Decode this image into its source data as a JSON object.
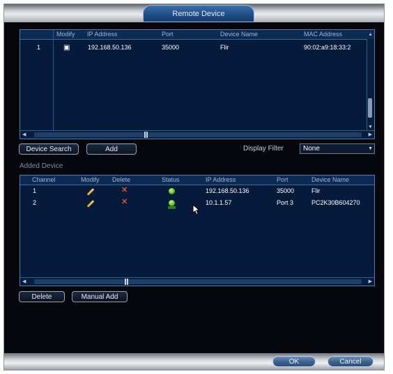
{
  "window": {
    "title": "Remote Device"
  },
  "search_table": {
    "columns": [
      "",
      "Modify",
      "IP Address",
      "Port",
      "Device Name",
      "MAC Address"
    ],
    "rows": [
      {
        "index": "1",
        "modify_icon": "edit-icon",
        "ip": "192.168.50.136",
        "port": "35000",
        "name": "Flir",
        "mac": "90:02:a9:18:33:2"
      }
    ]
  },
  "actions": {
    "device_search": "Device Search",
    "add": "Add"
  },
  "display_filter": {
    "label": "Display Filter",
    "value": "None"
  },
  "added_section": {
    "label": "Added Device"
  },
  "added_table": {
    "columns": [
      "Channel",
      "Modify",
      "Delete",
      "Status",
      "IP Address",
      "Port",
      "Device Name"
    ],
    "rows": [
      {
        "channel": "1",
        "ip": "192.168.50.136",
        "port": "35000",
        "name": "Flir"
      },
      {
        "channel": "2",
        "ip": "10.1.1.57",
        "port": "Port 3",
        "name": "PC2K30B604270"
      }
    ]
  },
  "added_actions": {
    "delete": "Delete",
    "manual_add": "Manual Add"
  },
  "footer": {
    "ok": "OK",
    "cancel": "Cancel"
  },
  "colors": {
    "panel_bg": "#061b3c",
    "border": "#4f7fb2",
    "edit": "#f0a020",
    "delete": "#e8502a",
    "status_ok": "#3fae1a"
  }
}
